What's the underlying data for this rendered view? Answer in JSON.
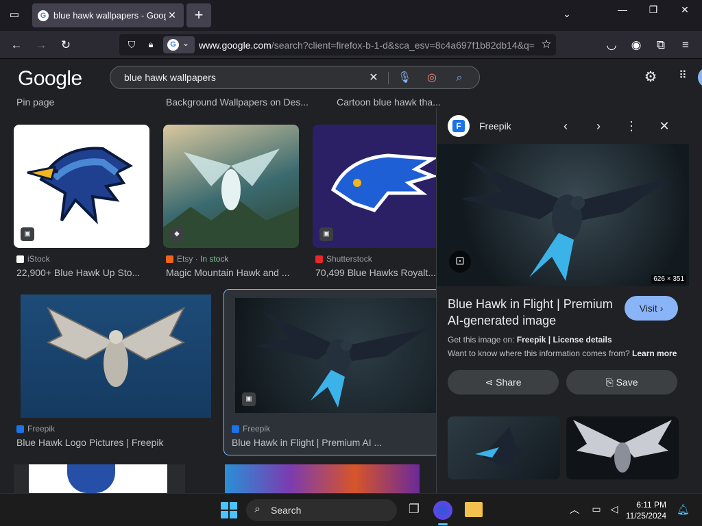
{
  "browser": {
    "tab_title": "blue hawk wallpapers - Google",
    "url_host": "www.google.com",
    "url_rest": "/search?client=firefox-b-1-d&sca_esv=8c4a697f1b82db14&q="
  },
  "google": {
    "logo": "Google",
    "query": "blue hawk wallpapers"
  },
  "top_captions": [
    "Pin page",
    "Background Wallpapers on Des...",
    "Cartoon blue hawk tha..."
  ],
  "results": [
    {
      "source": "iStock",
      "title": "22,900+ Blue Hawk Up Sto..."
    },
    {
      "source": "Etsy",
      "stock": "In stock",
      "title": "Magic Mountain Hawk and ..."
    },
    {
      "source": "Shutterstock",
      "title": "70,499 Blue Hawks Royalt..."
    },
    {
      "source": "Freepik",
      "title": "Blue Hawk Logo Pictures | Freepik"
    },
    {
      "source": "Freepik",
      "title": "Blue Hawk in Flight | Premium AI ..."
    }
  ],
  "panel": {
    "name": "Freepik",
    "dims": "626 × 351",
    "title": "Blue Hawk in Flight | Premium AI-generated image",
    "visit": "Visit",
    "get_prefix": "Get this image on:",
    "get_site": "Freepik",
    "get_sep": "|",
    "license": "License details",
    "want": "Want to know where this information comes from?",
    "learn_more": "Learn more",
    "share": "Share",
    "save": "Save"
  },
  "taskbar": {
    "search": "Search",
    "time": "6:11 PM",
    "date": "11/25/2024"
  },
  "colors": {
    "accent": "#8ab4f8",
    "page_bg": "#202124",
    "in_stock": "#81c995"
  }
}
